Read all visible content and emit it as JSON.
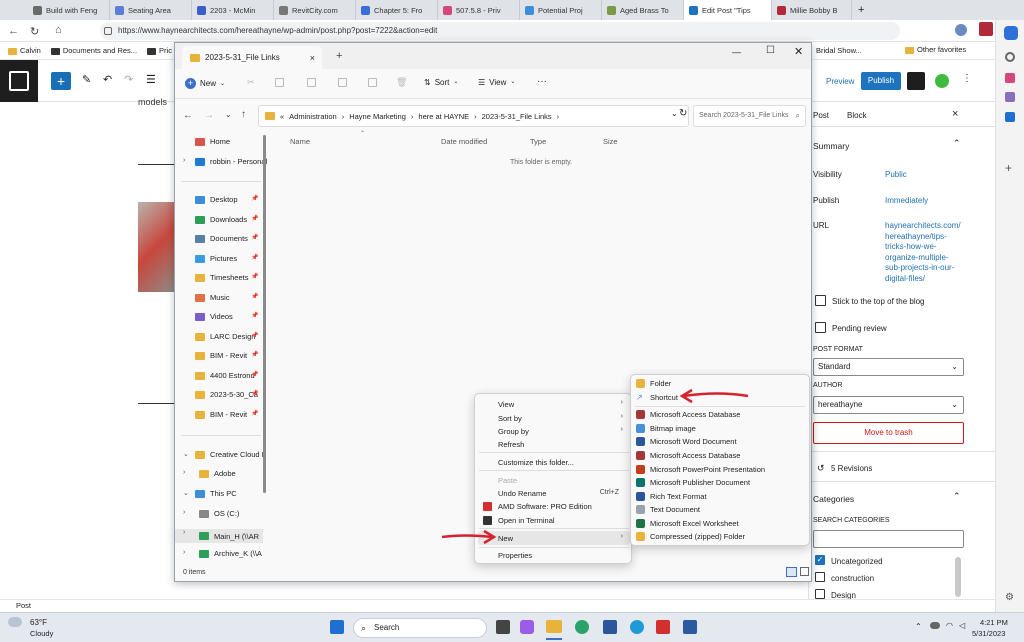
{
  "browser": {
    "tabs": [
      {
        "label": "Build with Feng"
      },
      {
        "label": "Seating Area"
      },
      {
        "label": "2203 - McMin"
      },
      {
        "label": "RevitCity.com"
      },
      {
        "label": "Chapter 5: Fro"
      },
      {
        "label": "507.5.8 - Priv"
      },
      {
        "label": "Potential Proj"
      },
      {
        "label": "Aged Brass To"
      },
      {
        "label": "Edit Post \"Tips"
      },
      {
        "label": "Millie Bobby B"
      }
    ],
    "url": "https://www.haynearchitects.com/hereathayne/wp-admin/post.php?post=7222&action=edit",
    "favorites": [
      "Calvin",
      "Documents and Res...",
      "Pric",
      "Bridal Show...",
      "Other favorites"
    ]
  },
  "wp": {
    "preview_label": "Preview",
    "publish_label": "Publish",
    "content_snippet": "models",
    "status_text": "Post",
    "sidebar": {
      "tab_post": "Post",
      "tab_block": "Block",
      "summary_heading": "Summary",
      "visibility_label": "Visibility",
      "visibility_value": "Public",
      "publish_label": "Publish",
      "publish_value": "Immediately",
      "url_label": "URL",
      "url_value_lines": [
        "haynearchitects.com/",
        "hereathayne/tips-",
        "tricks-how-we-",
        "organize-multiple-",
        "sub-projects-in-our-",
        "digital-files/"
      ],
      "sticky_label": "Stick to the top of the blog",
      "pending_label": "Pending review",
      "post_format_heading": "POST FORMAT",
      "post_format_value": "Standard",
      "author_heading": "AUTHOR",
      "author_value": "hereathayne",
      "trash_label": "Move to trash",
      "revisions_label": "5 Revisions",
      "categories_heading": "Categories",
      "search_categories_label": "SEARCH CATEGORIES",
      "categories": [
        "Uncategorized",
        "construction",
        "Design"
      ]
    }
  },
  "explorer": {
    "title": "2023-5-31_File Links",
    "toolbar": {
      "new_label": "New",
      "sort_label": "Sort",
      "view_label": "View"
    },
    "breadcrumb": [
      "Administration",
      "Hayne Marketing",
      "here at HAYNE",
      "2023-5-31_File Links"
    ],
    "search_placeholder": "Search 2023-5-31_File Links",
    "columns": [
      "Name",
      "Date modified",
      "Type",
      "Size"
    ],
    "empty_message": "This folder is empty.",
    "items_count": "0 items",
    "nav": [
      {
        "label": "Home",
        "color": "#d9534f"
      },
      {
        "label": "robbin - Personal",
        "color": "#1f7ad6"
      },
      {
        "label": "Desktop",
        "color": "#3b8ed8"
      },
      {
        "label": "Downloads",
        "color": "#2f9e58"
      },
      {
        "label": "Documents",
        "color": "#5a7fa8"
      },
      {
        "label": "Pictures",
        "color": "#3a9be0"
      },
      {
        "label": "Timesheets",
        "color": "#e8b33a"
      },
      {
        "label": "Music",
        "color": "#e0704a"
      },
      {
        "label": "Videos",
        "color": "#7b5fc8"
      },
      {
        "label": "LARC Design",
        "color": "#e8b33a"
      },
      {
        "label": "BIM - Revit",
        "color": "#e8b33a"
      },
      {
        "label": "4400 Estrond",
        "color": "#e8b33a"
      },
      {
        "label": "2023-5-30_Ca",
        "color": "#e8b33a"
      },
      {
        "label": "BIM - Revit",
        "color": "#e8b33a"
      },
      {
        "label": "Creative Cloud F",
        "color": "#e8b33a"
      },
      {
        "label": "Adobe",
        "color": "#e8b33a"
      },
      {
        "label": "This PC",
        "color": "#3b8ed8"
      },
      {
        "label": "OS (C:)",
        "color": "#888888"
      },
      {
        "label": "Main_H (\\\\AR",
        "color": "#2f9e58"
      },
      {
        "label": "Archive_K (\\\\A",
        "color": "#2f9e58"
      }
    ]
  },
  "context_menu": {
    "items": [
      "View",
      "Sort by",
      "Group by",
      "Refresh",
      "Customize this folder...",
      "Paste",
      "Undo Rename",
      "AMD Software: PRO Edition",
      "Open in Terminal",
      "New",
      "Properties"
    ],
    "undo_shortcut": "Ctrl+Z"
  },
  "new_submenu": {
    "items": [
      {
        "label": "Folder",
        "color": "#e8b33a"
      },
      {
        "label": "Shortcut",
        "color": "#3b8ed8"
      },
      {
        "label": "Microsoft Access Database",
        "color": "#a4373a"
      },
      {
        "label": "Bitmap image",
        "color": "#4a90d9"
      },
      {
        "label": "Microsoft Word Document",
        "color": "#2b579a"
      },
      {
        "label": "Microsoft Access Database",
        "color": "#a4373a"
      },
      {
        "label": "Microsoft PowerPoint Presentation",
        "color": "#c43e1c"
      },
      {
        "label": "Microsoft Publisher Document",
        "color": "#077568"
      },
      {
        "label": "Rich Text Format",
        "color": "#2b579a"
      },
      {
        "label": "Text Document",
        "color": "#9aa3ad"
      },
      {
        "label": "Microsoft Excel Worksheet",
        "color": "#217346"
      },
      {
        "label": "Compressed (zipped) Folder",
        "color": "#e8b33a"
      }
    ]
  },
  "taskbar": {
    "weather_temp": "63°F",
    "weather_desc": "Cloudy",
    "search_label": "Search",
    "time": "4:21 PM",
    "date": "5/31/2023"
  }
}
